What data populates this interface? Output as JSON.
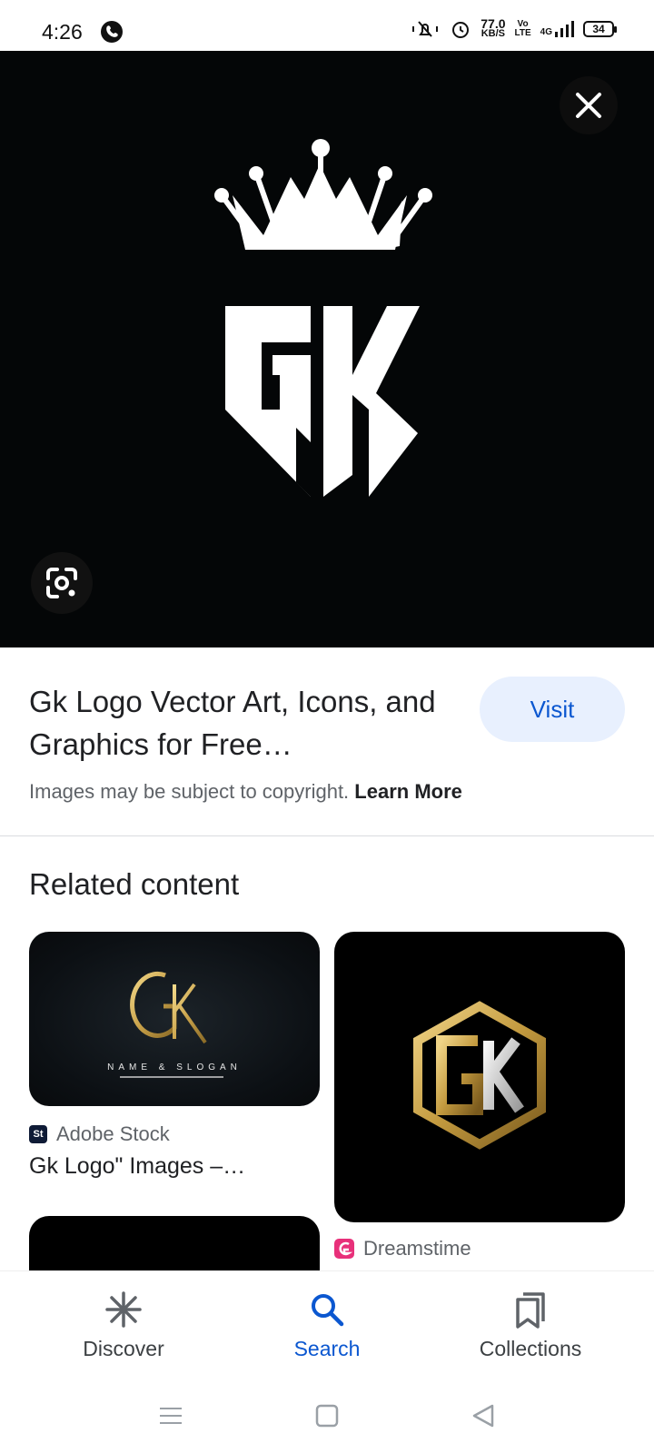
{
  "status_bar": {
    "time": "4:26",
    "speed_value": "77.0",
    "speed_unit": "KB/S",
    "volte_top": "Vo",
    "volte_bottom": "LTE",
    "network": "4G",
    "battery": "34"
  },
  "hero": {
    "close_icon": "close-icon",
    "lens_icon": "lens-icon",
    "logo_letters": "GK",
    "accent": "#ffffff",
    "background": "#040607"
  },
  "result": {
    "title": "Gk Logo Vector Art, Icons, and Graphics for Free…",
    "visit_label": "Visit",
    "copyright_text": "Images may be subject to copyright.",
    "learn_more": "Learn More"
  },
  "related": {
    "heading": "Related content",
    "cards": [
      {
        "logo_text": "GK",
        "slogan": "NAME & SLOGAN",
        "source": "Adobe Stock",
        "source_icon_text": "St",
        "caption": "Gk Logo\" Images –…"
      },
      {
        "logo_text": "GK",
        "source": "Dreamstime"
      }
    ]
  },
  "bottom_nav": {
    "items": [
      {
        "label": "Discover",
        "icon": "discover-icon",
        "active": false
      },
      {
        "label": "Search",
        "icon": "search-icon",
        "active": true
      },
      {
        "label": "Collections",
        "icon": "collections-icon",
        "active": false
      }
    ]
  },
  "colors": {
    "accent": "#0b57d0",
    "visit_bg": "#e8f0fe",
    "gold": "#c9a24a"
  }
}
